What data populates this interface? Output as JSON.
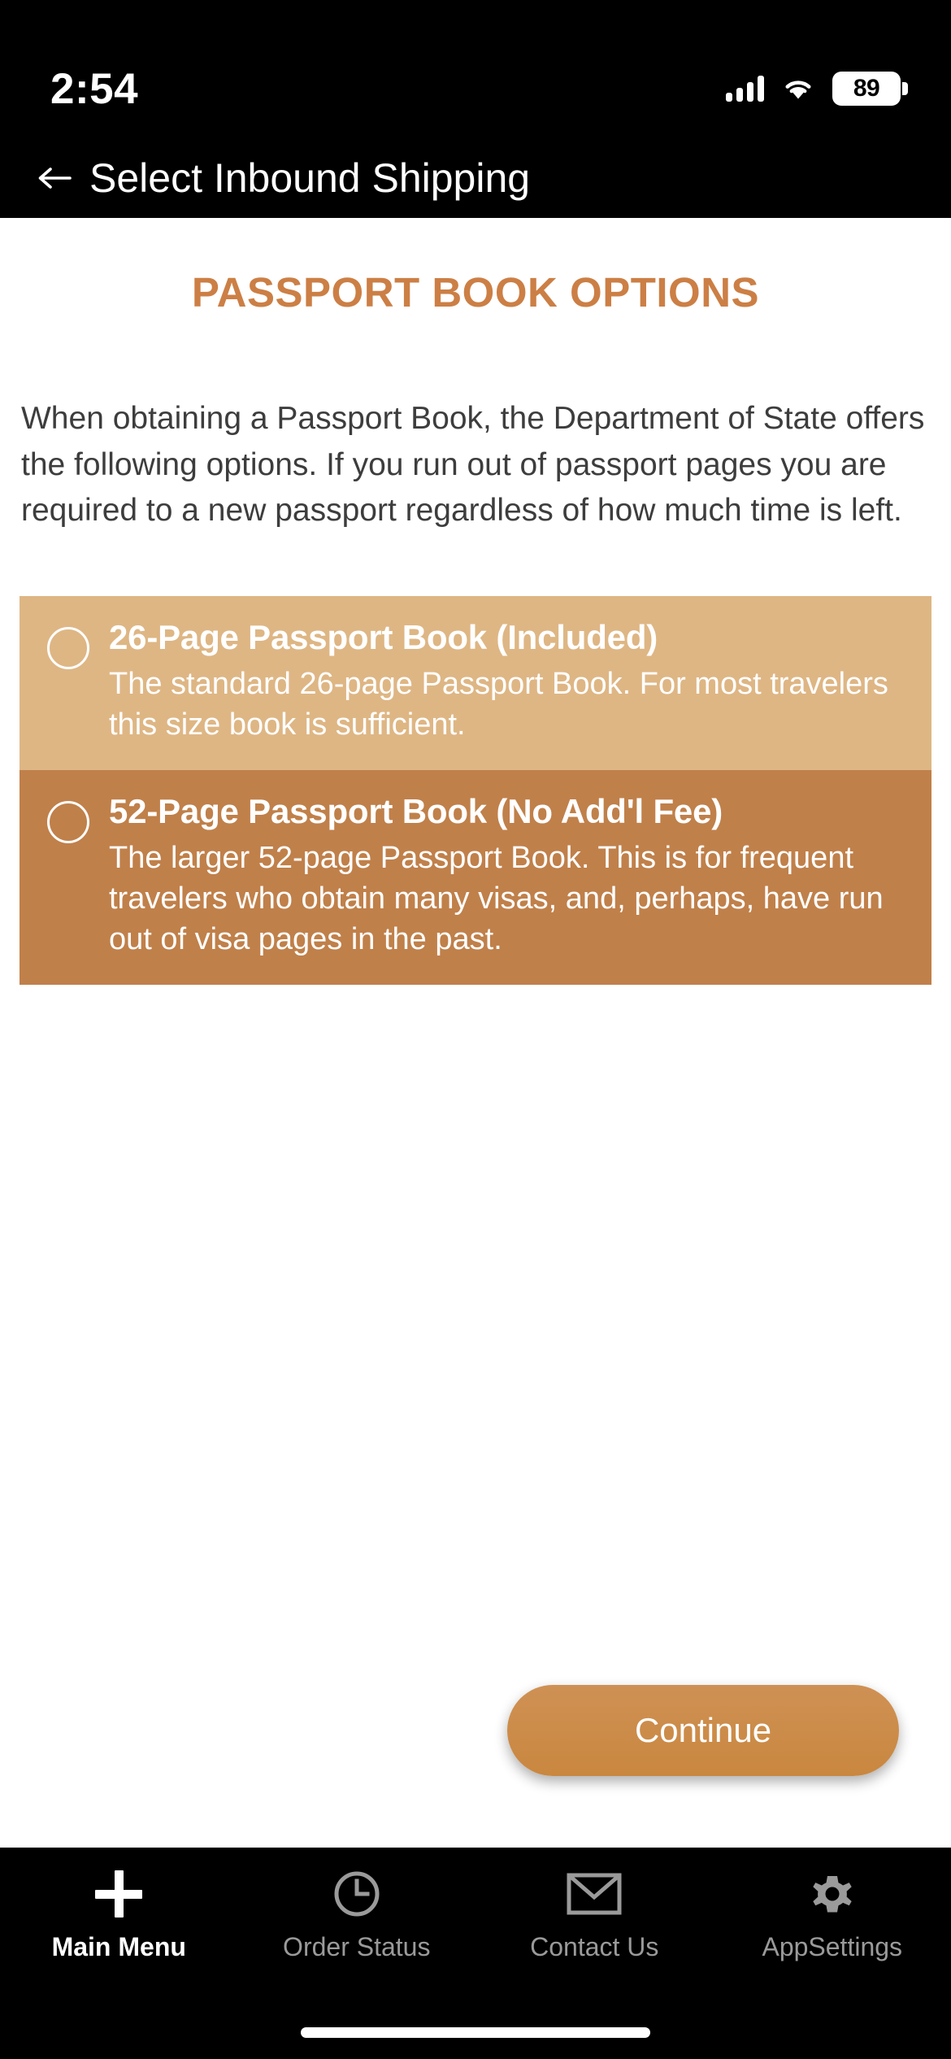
{
  "status_bar": {
    "time": "2:54",
    "battery_percent": "89",
    "signal_icon": "cellular-signal-icon",
    "wifi_icon": "wifi-icon",
    "battery_icon": "battery-icon"
  },
  "nav_bar": {
    "back_icon": "arrow-left-icon",
    "title": "Select Inbound Shipping"
  },
  "main": {
    "page_title": "PASSPORT BOOK OPTIONS",
    "intro": "When obtaining a Passport Book, the Department of State offers the following options.  If you run out of passport pages you are required to a new passport regardless of how much time is left.",
    "options": [
      {
        "title": "26-Page Passport Book (Included)",
        "description": "The standard 26-page Passport Book.  For most travelers this size book is sufficient.",
        "selected": false,
        "background": "#deb684"
      },
      {
        "title": "52-Page Passport Book (No Add'l Fee)",
        "description": "The larger 52-page Passport Book.  This is for frequent travelers who obtain many visas, and, perhaps, have run out of visa pages in the past.",
        "selected": false,
        "background": "#c0804a"
      }
    ],
    "continue_label": "Continue"
  },
  "tab_bar": {
    "tabs": [
      {
        "label": "Main Menu",
        "icon": "plus-icon",
        "active": true
      },
      {
        "label": "Order Status",
        "icon": "clock-icon",
        "active": false
      },
      {
        "label": "Contact Us",
        "icon": "envelope-icon",
        "active": false
      },
      {
        "label": "AppSettings",
        "icon": "gear-icon",
        "active": false
      }
    ]
  },
  "colors": {
    "accent": "#cc7f45",
    "option_light": "#deb684",
    "option_dark": "#c0804a",
    "tab_active": "#ffffff",
    "tab_inactive": "#9a9a9a"
  }
}
